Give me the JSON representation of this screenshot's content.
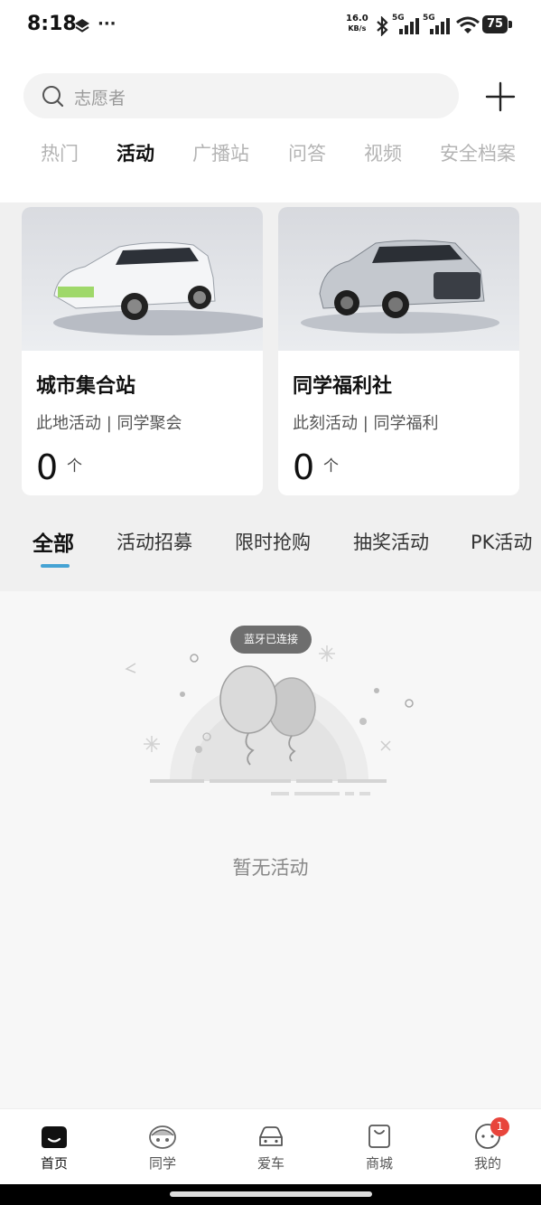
{
  "status_bar": {
    "time": "8:18",
    "net_speed_value": "16.0",
    "net_speed_unit": "KB/s",
    "signal_1": "5G",
    "signal_2": "5G",
    "battery": "75"
  },
  "search": {
    "placeholder": "志愿者",
    "icon": "search-icon"
  },
  "top_tabs": [
    {
      "label": "热门",
      "active": false
    },
    {
      "label": "活动",
      "active": true
    },
    {
      "label": "广播站",
      "active": false
    },
    {
      "label": "问答",
      "active": false
    },
    {
      "label": "视频",
      "active": false
    },
    {
      "label": "安全档案",
      "active": false
    }
  ],
  "cards": [
    {
      "title": "城市集合站",
      "subtitle": "此地活动 | 同学聚会",
      "count": "0",
      "unit": "个"
    },
    {
      "title": "同学福利社",
      "subtitle": "此刻活动 | 同学福利",
      "count": "0",
      "unit": "个"
    }
  ],
  "sub_tabs": [
    {
      "label": "全部",
      "active": true
    },
    {
      "label": "活动招募",
      "active": false
    },
    {
      "label": "限时抢购",
      "active": false
    },
    {
      "label": "抽奖活动",
      "active": false
    },
    {
      "label": "PK活动",
      "active": false
    }
  ],
  "toast": "蓝牙已连接",
  "empty_state": "暂无活动",
  "bottom_nav": [
    {
      "label": "首页",
      "icon": "home-icon",
      "active": true
    },
    {
      "label": "同学",
      "icon": "classmates-icon",
      "active": false
    },
    {
      "label": "爱车",
      "icon": "car-icon",
      "active": false
    },
    {
      "label": "商城",
      "icon": "shopping-bag-icon",
      "active": false
    },
    {
      "label": "我的",
      "icon": "profile-icon",
      "active": false,
      "badge": "1"
    }
  ],
  "colors": {
    "accent": "#45a3d4",
    "badge": "#e8453c"
  }
}
